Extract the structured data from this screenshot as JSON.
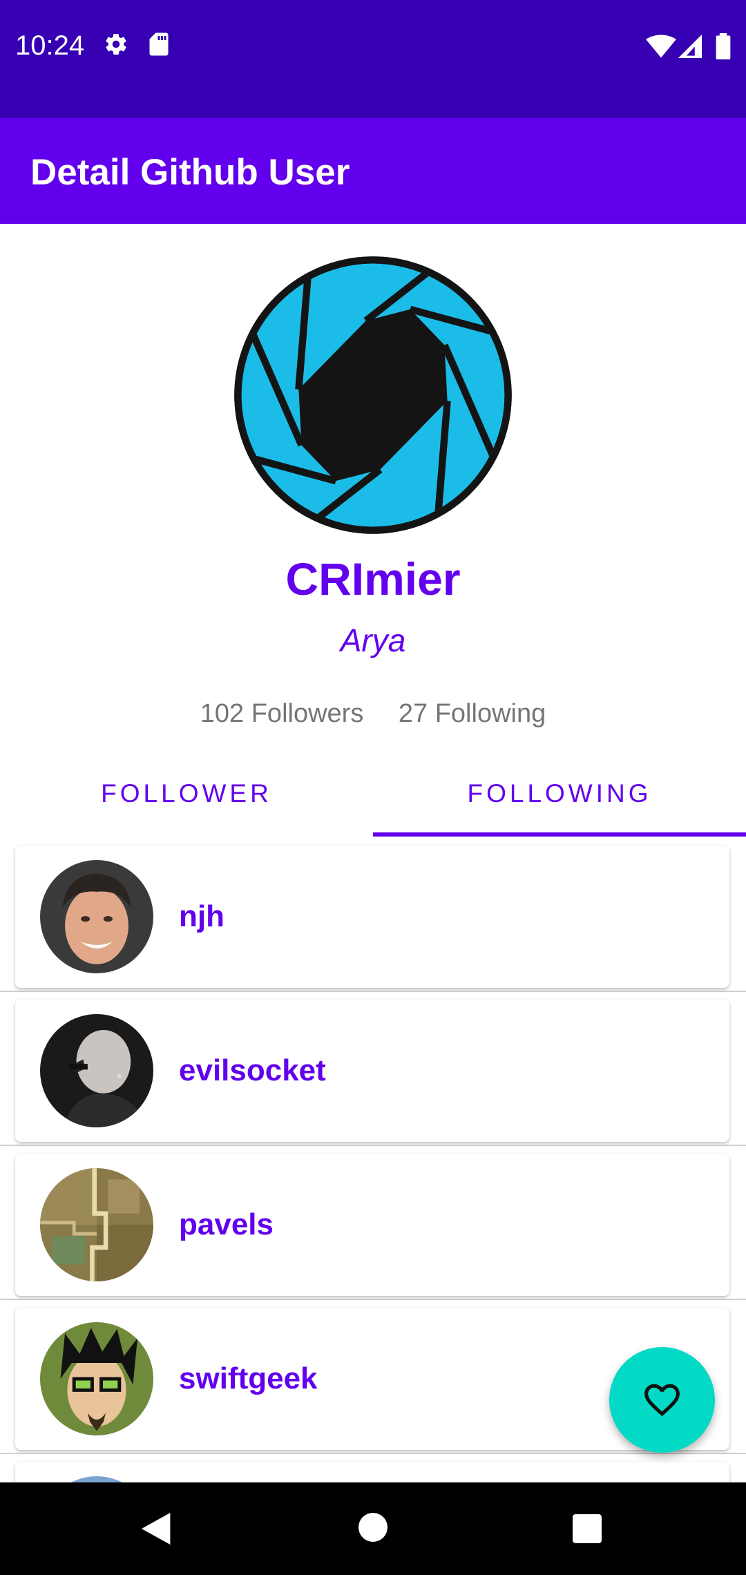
{
  "status_bar": {
    "time": "10:24",
    "left_icons": [
      "gear-icon",
      "sd-card-icon"
    ],
    "right_icons": [
      "wifi-icon",
      "signal-icon",
      "battery-icon"
    ],
    "background": "#3700B3"
  },
  "app_bar": {
    "title": "Detail Github User",
    "background": "#6200EE"
  },
  "profile": {
    "avatar_icon": "camera-aperture-avatar",
    "username": "CRImier",
    "name": "Arya",
    "followers": "102 Followers",
    "following": "27 Following"
  },
  "tabs": [
    {
      "label": "FOLLOWER",
      "selected": false
    },
    {
      "label": "FOLLOWING",
      "selected": true
    }
  ],
  "users": [
    {
      "login": "njh"
    },
    {
      "login": "evilsocket"
    },
    {
      "login": "pavels"
    },
    {
      "login": "swiftgeek"
    }
  ],
  "fab": {
    "icon": "heart-outline-icon",
    "color": "#03DAC5"
  },
  "nav_bar": {
    "icons": [
      "back-icon",
      "home-icon",
      "recents-icon"
    ]
  },
  "colors": {
    "primary": "#6200EE",
    "primary_dark": "#3700B3",
    "accent": "#03DAC5",
    "secondary_text": "#757575"
  }
}
